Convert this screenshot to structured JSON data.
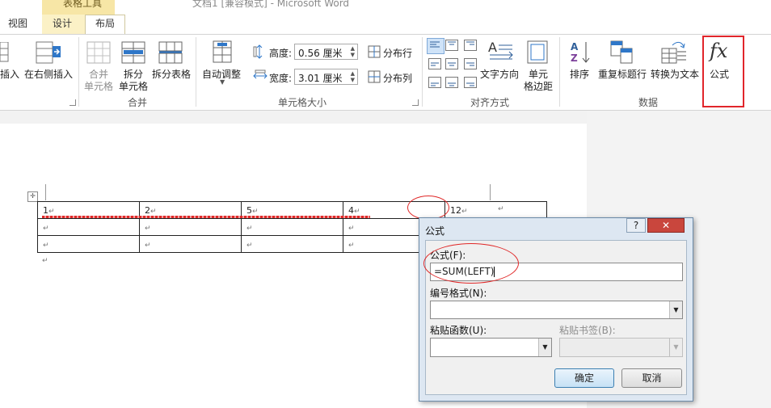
{
  "window": {
    "title": "文档1 [兼容模式] - Microsoft Word",
    "context_tab": "表格工具"
  },
  "tabs": {
    "view": "视图",
    "design": "设计",
    "layout": "布局"
  },
  "ribbon": {
    "insert_partial": "插入",
    "insert_right": "在右侧插入",
    "merge_cells_l1": "合并",
    "merge_cells_l2": "单元格",
    "split_cells_l1": "拆分",
    "split_cells_l2": "单元格",
    "split_table": "拆分表格",
    "merge_group": "合并",
    "autofit": "自动调整",
    "height_label": "高度:",
    "height_value": "0.56 厘米",
    "width_label": "宽度:",
    "width_value": "3.01 厘米",
    "distribute_rows": "分布行",
    "distribute_cols": "分布列",
    "cell_size_group": "单元格大小",
    "text_direction": "文字方向",
    "cell_margins_l1": "单元",
    "cell_margins_l2": "格边距",
    "align_group": "对齐方式",
    "sort": "排序",
    "repeat_header": "重复标题行",
    "convert_text": "转换为文本",
    "formula": "公式",
    "formula_icon": "fx",
    "data_group": "数据"
  },
  "table": {
    "rows": [
      [
        "1",
        "2",
        "5",
        "4",
        "12"
      ],
      [
        "",
        "",
        "",
        "",
        ""
      ],
      [
        "",
        "",
        "",
        "",
        ""
      ]
    ],
    "para_mark": "↵"
  },
  "dialog": {
    "title": "公式",
    "help": "?",
    "close": "✕",
    "formula_label": "公式(F):",
    "formula_value": "=SUM(LEFT)",
    "number_format_label": "编号格式(N):",
    "number_format_value": "",
    "paste_function_label": "粘贴函数(U):",
    "paste_function_value": "",
    "paste_bookmark_label": "粘贴书签(B):",
    "paste_bookmark_value": "",
    "ok": "确定",
    "cancel": "取消"
  },
  "colors": {
    "highlight_red": "#e1252b",
    "context_tab": "#f7e6a6"
  }
}
